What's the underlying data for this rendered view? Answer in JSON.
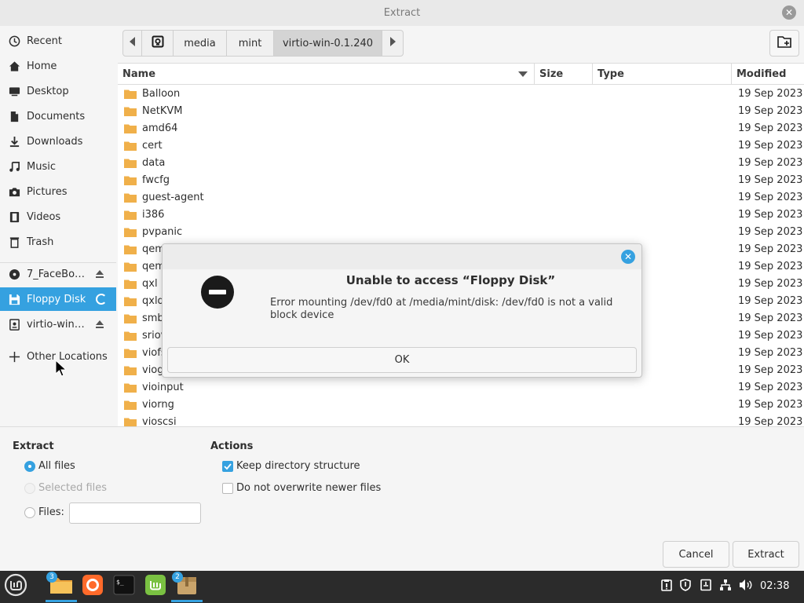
{
  "window": {
    "title": "Extract"
  },
  "sidebar": {
    "items": [
      {
        "label": "Recent",
        "icon": "clock-icon"
      },
      {
        "label": "Home",
        "icon": "home-icon"
      },
      {
        "label": "Desktop",
        "icon": "desktop-icon"
      },
      {
        "label": "Documents",
        "icon": "documents-icon"
      },
      {
        "label": "Downloads",
        "icon": "download-icon"
      },
      {
        "label": "Music",
        "icon": "music-icon"
      },
      {
        "label": "Pictures",
        "icon": "camera-icon"
      },
      {
        "label": "Videos",
        "icon": "film-icon"
      },
      {
        "label": "Trash",
        "icon": "trash-icon"
      }
    ],
    "devices": [
      {
        "label": "7_FaceBo…",
        "icon": "disc-icon"
      },
      {
        "label": "Floppy Disk",
        "icon": "floppy-icon"
      },
      {
        "label": "virtio-win-…",
        "icon": "drive-icon"
      }
    ],
    "other": {
      "label": "Other Locations"
    }
  },
  "pathbar": {
    "segments": [
      "media",
      "mint",
      "virtio-win-0.1.240"
    ]
  },
  "filelist": {
    "columns": {
      "name": "Name",
      "size": "Size",
      "type": "Type",
      "modified": "Modified"
    },
    "rows": [
      {
        "name": "Balloon",
        "modified": "19 Sep 2023"
      },
      {
        "name": "NetKVM",
        "modified": "19 Sep 2023"
      },
      {
        "name": "amd64",
        "modified": "19 Sep 2023"
      },
      {
        "name": "cert",
        "modified": "19 Sep 2023"
      },
      {
        "name": "data",
        "modified": "19 Sep 2023"
      },
      {
        "name": "fwcfg",
        "modified": "19 Sep 2023"
      },
      {
        "name": "guest-agent",
        "modified": "19 Sep 2023"
      },
      {
        "name": "i386",
        "modified": "19 Sep 2023"
      },
      {
        "name": "pvpanic",
        "modified": "19 Sep 2023"
      },
      {
        "name": "qem",
        "modified": "19 Sep 2023"
      },
      {
        "name": "qem",
        "modified": "19 Sep 2023"
      },
      {
        "name": "qxl",
        "modified": "19 Sep 2023"
      },
      {
        "name": "qxld",
        "modified": "19 Sep 2023"
      },
      {
        "name": "smb",
        "modified": "19 Sep 2023"
      },
      {
        "name": "sriov",
        "modified": "19 Sep 2023"
      },
      {
        "name": "viofs",
        "modified": "19 Sep 2023"
      },
      {
        "name": "viog",
        "modified": "19 Sep 2023"
      },
      {
        "name": "vioinput",
        "modified": "19 Sep 2023"
      },
      {
        "name": "viorng",
        "modified": "19 Sep 2023"
      },
      {
        "name": "vioscsi",
        "modified": "19 Sep 2023"
      }
    ]
  },
  "options": {
    "extract_title": "Extract",
    "all_files": "All files",
    "selected_files": "Selected files",
    "files_label": "Files:",
    "files_value": "",
    "actions_title": "Actions",
    "keep_structure": "Keep directory structure",
    "no_overwrite": "Do not overwrite newer files",
    "cancel": "Cancel",
    "extract": "Extract"
  },
  "dialog": {
    "heading": "Unable to access “Floppy Disk”",
    "message": "Error mounting /dev/fd0 at /media/mint/disk: /dev/fd0 is not a valid block device",
    "ok": "OK"
  },
  "taskbar": {
    "badges": {
      "files": "3",
      "archive": "2"
    },
    "clock": "02:38"
  },
  "colors": {
    "accent": "#35a1e0",
    "folder": "#f0b04a",
    "taskbar": "#2b2b2b"
  }
}
